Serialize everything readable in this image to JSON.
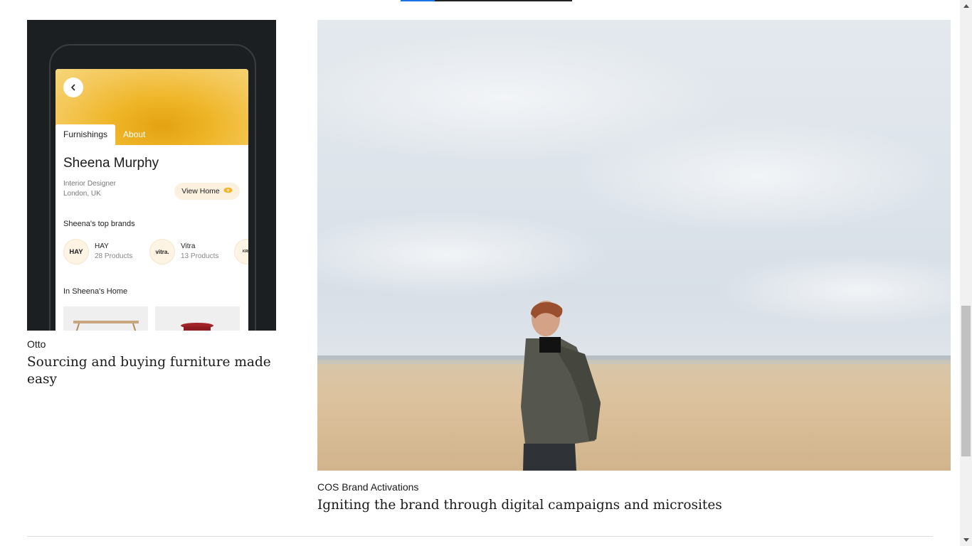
{
  "top_progress": {
    "fraction": 0.2
  },
  "projects": [
    {
      "category": "Otto",
      "title": "Sourcing and buying furniture made easy",
      "app_preview": {
        "tabs": [
          "Furnishings",
          "About"
        ],
        "name": "Sheena Murphy",
        "role": "Interior Designer",
        "location": "London, UK",
        "view_home_label": "View Home",
        "top_brands_heading": "Sheena's top brands",
        "brands": [
          {
            "logo": "HAY",
            "name": "HAY",
            "count": "28 Products"
          },
          {
            "logo": "vitra.",
            "name": "Vitra",
            "count": "13 Products"
          },
          {
            "logo": "KRIS"
          }
        ],
        "home_heading": "In Sheena's Home"
      }
    },
    {
      "category": "COS Brand Activations",
      "title": "Igniting the brand through digital campaigns and microsites"
    }
  ],
  "colors": {
    "accent": "#1a73e8",
    "app_yellow": "#f0b429",
    "dark_bg": "#1c1f22"
  }
}
